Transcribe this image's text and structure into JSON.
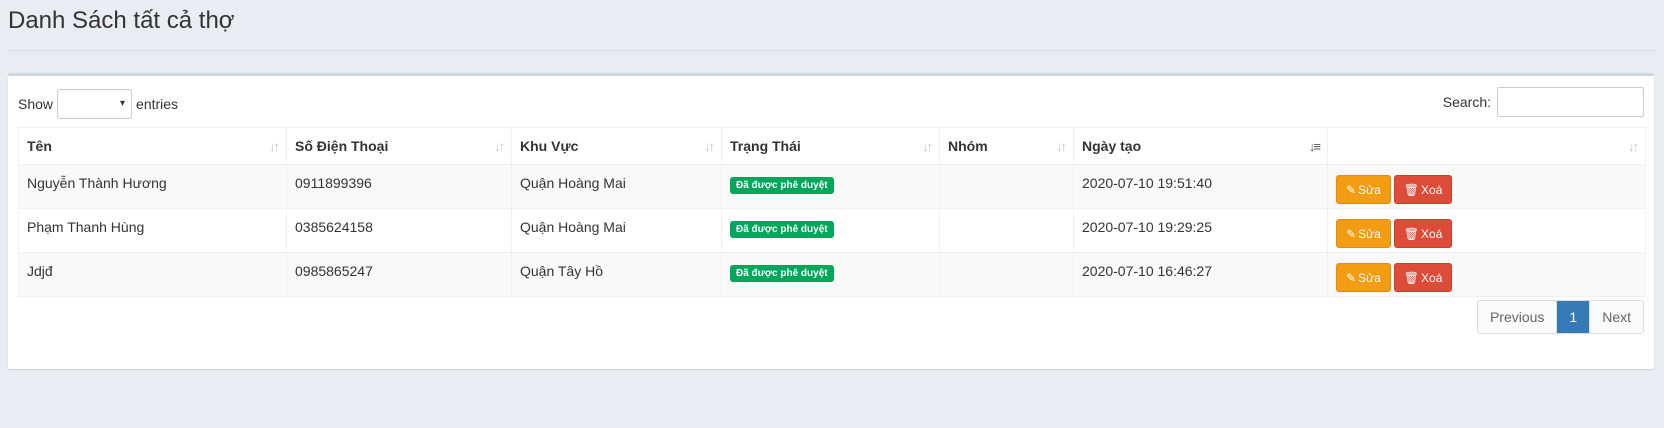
{
  "page": {
    "title": "Danh Sách tất cả thợ"
  },
  "length": {
    "show_label": "Show",
    "entries_label": "entries",
    "selected": ""
  },
  "search": {
    "label": "Search:",
    "value": ""
  },
  "table": {
    "columns": [
      "Tên",
      "Số Điện Thoại",
      "Khu Vực",
      "Trạng Thái",
      "Nhóm",
      "Ngày tạo",
      ""
    ],
    "rows": [
      {
        "name": "Nguyễn Thành Hương",
        "phone": "0911899396",
        "area": "Quận Hoàng Mai",
        "status": "Đã được phê duyệt",
        "group": "",
        "created": "2020-07-10 19:51:40"
      },
      {
        "name": "Phạm Thanh Hùng",
        "phone": "0385624158",
        "area": "Quận Hoàng Mai",
        "status": "Đã được phê duyệt",
        "group": "",
        "created": "2020-07-10 19:29:25"
      },
      {
        "name": "Jdjđ",
        "phone": "0985865247",
        "area": "Quận Tây Hồ",
        "status": "Đã được phê duyệt",
        "group": "",
        "created": "2020-07-10 16:46:27"
      }
    ],
    "actions": {
      "edit_label": "Sửa",
      "delete_label": "Xoá"
    }
  },
  "pagination": {
    "previous": "Previous",
    "current": "1",
    "next": "Next"
  },
  "colors": {
    "status_badge": "#00a65a",
    "edit": "#f39c12",
    "delete": "#dd4b39",
    "page_active": "#337ab7"
  }
}
